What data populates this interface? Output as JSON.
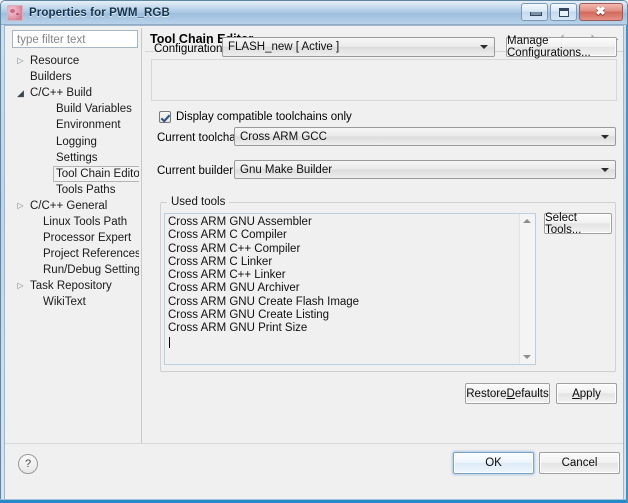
{
  "window": {
    "title": "Properties for PWM_RGB",
    "icon": "project-properties-icon",
    "minimize_label": "Minimize",
    "maximize_label": "Maximize",
    "close_label": "Close",
    "close_glyph": "✖"
  },
  "filter": {
    "placeholder": "type filter text",
    "value": ""
  },
  "tree": {
    "items": [
      {
        "label": "Resource",
        "indent": 1,
        "twisty": "closed",
        "selected": false
      },
      {
        "label": "Builders",
        "indent": 1,
        "twisty": "none",
        "selected": false
      },
      {
        "label": "C/C++ Build",
        "indent": 1,
        "twisty": "open",
        "selected": false
      },
      {
        "label": "Build Variables",
        "indent": 3,
        "twisty": "none",
        "selected": false
      },
      {
        "label": "Environment",
        "indent": 3,
        "twisty": "none",
        "selected": false
      },
      {
        "label": "Logging",
        "indent": 3,
        "twisty": "none",
        "selected": false
      },
      {
        "label": "Settings",
        "indent": 3,
        "twisty": "none",
        "selected": false
      },
      {
        "label": "Tool Chain Editor",
        "indent": 3,
        "twisty": "none",
        "selected": true
      },
      {
        "label": "Tools Paths",
        "indent": 3,
        "twisty": "none",
        "selected": false
      },
      {
        "label": "C/C++ General",
        "indent": 1,
        "twisty": "closed",
        "selected": false
      },
      {
        "label": "Linux Tools Path",
        "indent": 2,
        "twisty": "none",
        "selected": false
      },
      {
        "label": "Processor Expert",
        "indent": 2,
        "twisty": "none",
        "selected": false
      },
      {
        "label": "Project References",
        "indent": 2,
        "twisty": "none",
        "selected": false
      },
      {
        "label": "Run/Debug Settings",
        "indent": 2,
        "twisty": "none",
        "selected": false
      },
      {
        "label": "Task Repository",
        "indent": 1,
        "twisty": "closed",
        "selected": false
      },
      {
        "label": "WikiText",
        "indent": 2,
        "twisty": "none",
        "selected": false
      }
    ]
  },
  "page": {
    "title": "Tool Chain Editor",
    "nav": {
      "back_label": "Back",
      "back_menu_label": "Back history",
      "forward_label": "Forward",
      "forward_menu_label": "Forward history",
      "view_menu_label": "View menu"
    }
  },
  "configuration": {
    "label": "Configuration:",
    "value": "FLASH_new  [ Active ]",
    "manage_button": "Manage Configurations..."
  },
  "toolchain": {
    "compatible_only_label": "Display compatible toolchains only",
    "compatible_only_checked": true,
    "current_toolchain_label": "Current toolchain:",
    "current_toolchain_value": "Cross ARM GCC",
    "current_builder_label": "Current builder:",
    "current_builder_value": "Gnu Make Builder"
  },
  "used_tools": {
    "group_label": "Used tools",
    "items": [
      "Cross ARM GNU Assembler",
      "Cross ARM C Compiler",
      "Cross ARM C++ Compiler",
      "Cross ARM C Linker",
      "Cross ARM C++ Linker",
      "Cross ARM GNU Archiver",
      "Cross ARM GNU Create Flash Image",
      "Cross ARM GNU Create Listing",
      "Cross ARM GNU Print Size"
    ],
    "select_tools_button": "Select Tools..."
  },
  "actions": {
    "restore_defaults_pre": "Restore ",
    "restore_defaults_mnemonic": "D",
    "restore_defaults_post": "efaults",
    "apply_mnemonic": "A",
    "apply_post": "pply",
    "ok": "OK",
    "cancel": "Cancel",
    "help": "?"
  },
  "colors": {
    "accent": "#3f93cc",
    "dialog_bg": "#f0f0f0",
    "title_bar": "#a8c6e3",
    "close_button": "#d2685c",
    "selection_border": "#b4b4b4",
    "list_border": "#b9d0e3"
  }
}
